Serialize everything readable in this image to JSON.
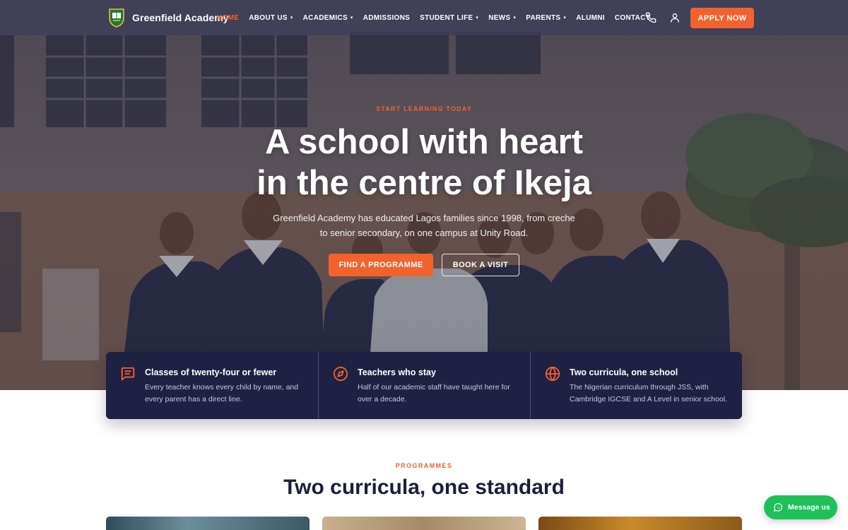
{
  "nav": {
    "brand": "Greenfield Academy",
    "items": [
      {
        "label": "HOME",
        "dropdown": false,
        "active": true
      },
      {
        "label": "ABOUT US",
        "dropdown": true,
        "active": false
      },
      {
        "label": "ACADEMICS",
        "dropdown": true,
        "active": false
      },
      {
        "label": "ADMISSIONS",
        "dropdown": false,
        "active": false
      },
      {
        "label": "STUDENT LIFE",
        "dropdown": true,
        "active": false
      },
      {
        "label": "NEWS",
        "dropdown": true,
        "active": false
      },
      {
        "label": "PARENTS",
        "dropdown": true,
        "active": false
      },
      {
        "label": "ALUMNI",
        "dropdown": false,
        "active": false
      },
      {
        "label": "CONTACT",
        "dropdown": false,
        "active": false
      }
    ],
    "icons": [
      "phone-icon",
      "user-icon"
    ],
    "apply_label": "APPLY NOW"
  },
  "hero": {
    "eyebrow": "START LEARNING TODAY",
    "title_line1": "A school with heart",
    "title_line2": "in the centre of Ikeja",
    "subtitle": "Greenfield Academy has educated Lagos families since 1998, from creche to senior secondary, on one campus at Unity Road.",
    "primary_button": "FIND A PROGRAMME",
    "secondary_button": "BOOK A VISIT"
  },
  "features": [
    {
      "icon": "message-square-icon",
      "title": "Classes of twenty-four or fewer",
      "text": "Every teacher knows every child by name, and every parent has a direct line."
    },
    {
      "icon": "compass-icon",
      "title": "Teachers who stay",
      "text": "Half of our academic staff have taught here for over a decade."
    },
    {
      "icon": "globe-icon",
      "title": "Two curricula, one school",
      "text": "The Nigerian curriculum through JSS, with Cambridge IGCSE and A Level in senior school."
    }
  ],
  "programmes": {
    "eyebrow": "PROGRAMMES",
    "title": "Two curricula, one standard"
  },
  "whatsapp": {
    "label": "Message us",
    "icon": "whatsapp-icon"
  },
  "colors": {
    "accent": "#f2622e",
    "navy": "#1f2142",
    "whatsapp": "#1fbf5a"
  }
}
